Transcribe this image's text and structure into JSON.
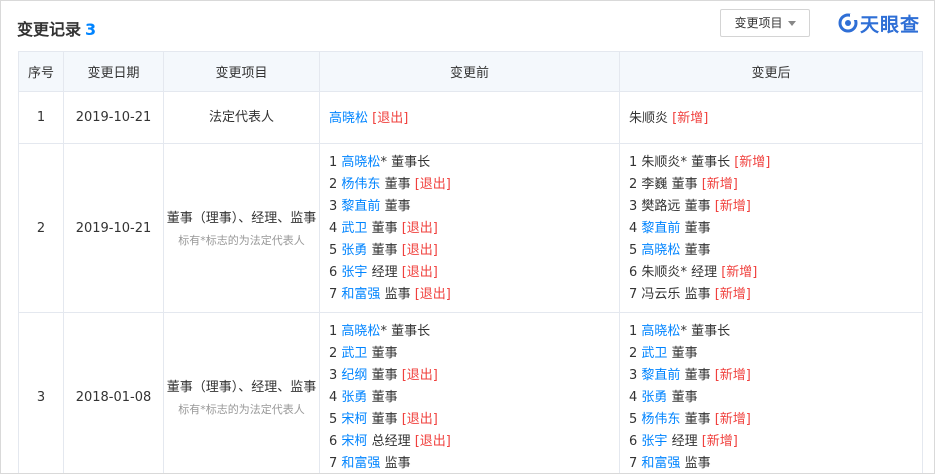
{
  "header": {
    "title": "变更记录",
    "count": "3",
    "filter_label": "变更项目",
    "logo_text": "天眼查"
  },
  "colors": {
    "link": "#0084ff",
    "tag": "#f0413e",
    "header_bg": "#f4f8fc"
  },
  "table": {
    "columns": [
      "序号",
      "变更日期",
      "变更项目",
      "变更前",
      "变更后"
    ],
    "rows": [
      {
        "index": "1",
        "date": "2019-10-21",
        "item": "法定代表人",
        "note": "",
        "before": [
          {
            "num": "",
            "name": "高晓松",
            "link": true,
            "suffix": " ",
            "tag": "[退出]"
          }
        ],
        "after": [
          {
            "num": "",
            "name": "朱顺炎",
            "link": false,
            "suffix": " ",
            "tag": "[新增]"
          }
        ]
      },
      {
        "index": "2",
        "date": "2019-10-21",
        "item": "董事（理事）、经理、监事",
        "note": "标有*标志的为法定代表人",
        "before": [
          {
            "num": "1",
            "name": "高晓松",
            "link": true,
            "suffix": "* 董事长",
            "tag": ""
          },
          {
            "num": "2",
            "name": "杨伟东",
            "link": true,
            "suffix": " 董事 ",
            "tag": "[退出]"
          },
          {
            "num": "3",
            "name": "黎直前",
            "link": true,
            "suffix": " 董事",
            "tag": ""
          },
          {
            "num": "4",
            "name": "武卫",
            "link": true,
            "suffix": " 董事 ",
            "tag": "[退出]"
          },
          {
            "num": "5",
            "name": "张勇",
            "link": true,
            "suffix": " 董事 ",
            "tag": "[退出]"
          },
          {
            "num": "6",
            "name": "张宇",
            "link": true,
            "suffix": " 经理 ",
            "tag": "[退出]"
          },
          {
            "num": "7",
            "name": "和富强",
            "link": true,
            "suffix": " 监事 ",
            "tag": "[退出]"
          }
        ],
        "after": [
          {
            "num": "1",
            "name": "朱顺炎",
            "link": false,
            "suffix": "* 董事长 ",
            "tag": "[新增]"
          },
          {
            "num": "2",
            "name": "李巍",
            "link": false,
            "suffix": " 董事 ",
            "tag": "[新增]"
          },
          {
            "num": "3",
            "name": "樊路远",
            "link": false,
            "suffix": " 董事 ",
            "tag": "[新增]"
          },
          {
            "num": "4",
            "name": "黎直前",
            "link": true,
            "suffix": " 董事",
            "tag": ""
          },
          {
            "num": "5",
            "name": "高晓松",
            "link": true,
            "suffix": " 董事",
            "tag": ""
          },
          {
            "num": "6",
            "name": "朱顺炎",
            "link": false,
            "suffix": "* 经理 ",
            "tag": "[新增]"
          },
          {
            "num": "7",
            "name": "冯云乐",
            "link": false,
            "suffix": " 监事 ",
            "tag": "[新增]"
          }
        ]
      },
      {
        "index": "3",
        "date": "2018-01-08",
        "item": "董事（理事）、经理、监事",
        "note": "标有*标志的为法定代表人",
        "before": [
          {
            "num": "1",
            "name": "高晓松",
            "link": true,
            "suffix": "* 董事长",
            "tag": ""
          },
          {
            "num": "2",
            "name": "武卫",
            "link": true,
            "suffix": " 董事",
            "tag": ""
          },
          {
            "num": "3",
            "name": "纪纲",
            "link": true,
            "suffix": " 董事 ",
            "tag": "[退出]"
          },
          {
            "num": "4",
            "name": "张勇",
            "link": true,
            "suffix": " 董事",
            "tag": ""
          },
          {
            "num": "5",
            "name": "宋柯",
            "link": true,
            "suffix": " 董事 ",
            "tag": "[退出]"
          },
          {
            "num": "6",
            "name": "宋柯",
            "link": true,
            "suffix": " 总经理 ",
            "tag": "[退出]"
          },
          {
            "num": "7",
            "name": "和富强",
            "link": true,
            "suffix": " 监事",
            "tag": ""
          }
        ],
        "after": [
          {
            "num": "1",
            "name": "高晓松",
            "link": true,
            "suffix": "* 董事长",
            "tag": ""
          },
          {
            "num": "2",
            "name": "武卫",
            "link": true,
            "suffix": " 董事",
            "tag": ""
          },
          {
            "num": "3",
            "name": "黎直前",
            "link": true,
            "suffix": " 董事 ",
            "tag": "[新增]"
          },
          {
            "num": "4",
            "name": "张勇",
            "link": true,
            "suffix": " 董事",
            "tag": ""
          },
          {
            "num": "5",
            "name": "杨伟东",
            "link": true,
            "suffix": " 董事 ",
            "tag": "[新增]"
          },
          {
            "num": "6",
            "name": "张宇",
            "link": true,
            "suffix": " 经理 ",
            "tag": "[新增]"
          },
          {
            "num": "7",
            "name": "和富强",
            "link": true,
            "suffix": " 监事",
            "tag": ""
          }
        ]
      }
    ]
  }
}
